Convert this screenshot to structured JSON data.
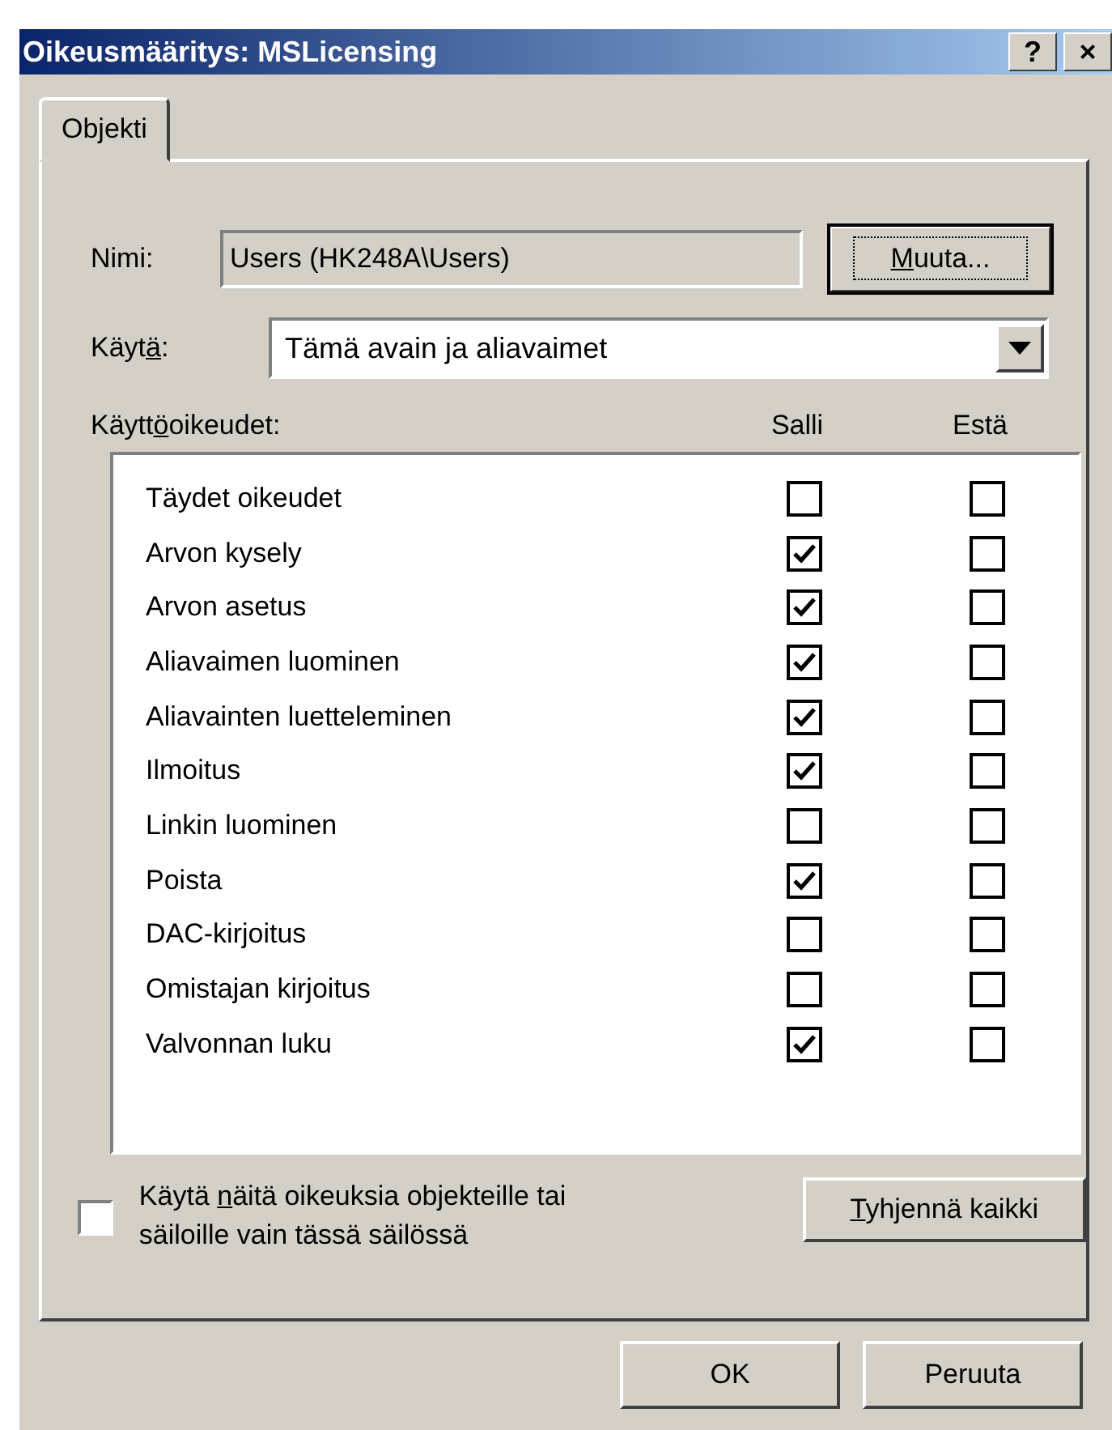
{
  "window": {
    "title": "Oikeusmääritys: MSLicensing",
    "title_buttons": [
      "?",
      "×"
    ]
  },
  "tabs": [
    {
      "label": "Objekti",
      "selected": true
    }
  ],
  "name_row": {
    "label": "Nimi:",
    "value": "Users (HK248A\\Users)",
    "button": {
      "key": "M",
      "post": "uuta..."
    }
  },
  "apply_row": {
    "label": {
      "pre": "Käyt",
      "key": "ä",
      "post": ":"
    },
    "value": "Tämä avain ja aliavaimet"
  },
  "permissions": {
    "heading": {
      "pre": "Käytt",
      "key": "ö",
      "post": "oikeudet:"
    },
    "columns": [
      "Salli",
      "Estä"
    ],
    "rows": [
      {
        "name": "Täydet oikeudet",
        "allow": false,
        "deny": false
      },
      {
        "name": "Arvon kysely",
        "allow": true,
        "deny": false
      },
      {
        "name": "Arvon asetus",
        "allow": true,
        "deny": false
      },
      {
        "name": "Aliavaimen luominen",
        "allow": true,
        "deny": false
      },
      {
        "name": "Aliavainten luetteleminen",
        "allow": true,
        "deny": false
      },
      {
        "name": "Ilmoitus",
        "allow": true,
        "deny": false
      },
      {
        "name": "Linkin luominen",
        "allow": false,
        "deny": false
      },
      {
        "name": "Poista",
        "allow": true,
        "deny": false
      },
      {
        "name": "DAC-kirjoitus",
        "allow": false,
        "deny": false
      },
      {
        "name": "Omistajan kirjoitus",
        "allow": false,
        "deny": false
      },
      {
        "name": "Valvonnan luku",
        "allow": true,
        "deny": false
      }
    ]
  },
  "inherit_option": {
    "checked": false,
    "label": {
      "pre": "Käytä ",
      "key": "n",
      "post": "äitä oikeuksia objekteille tai säiloille vain tässä säilössä"
    }
  },
  "clear_button": {
    "key": "T",
    "post": "yhjennä kaikki"
  },
  "buttons": [
    "OK",
    "Peruuta"
  ]
}
